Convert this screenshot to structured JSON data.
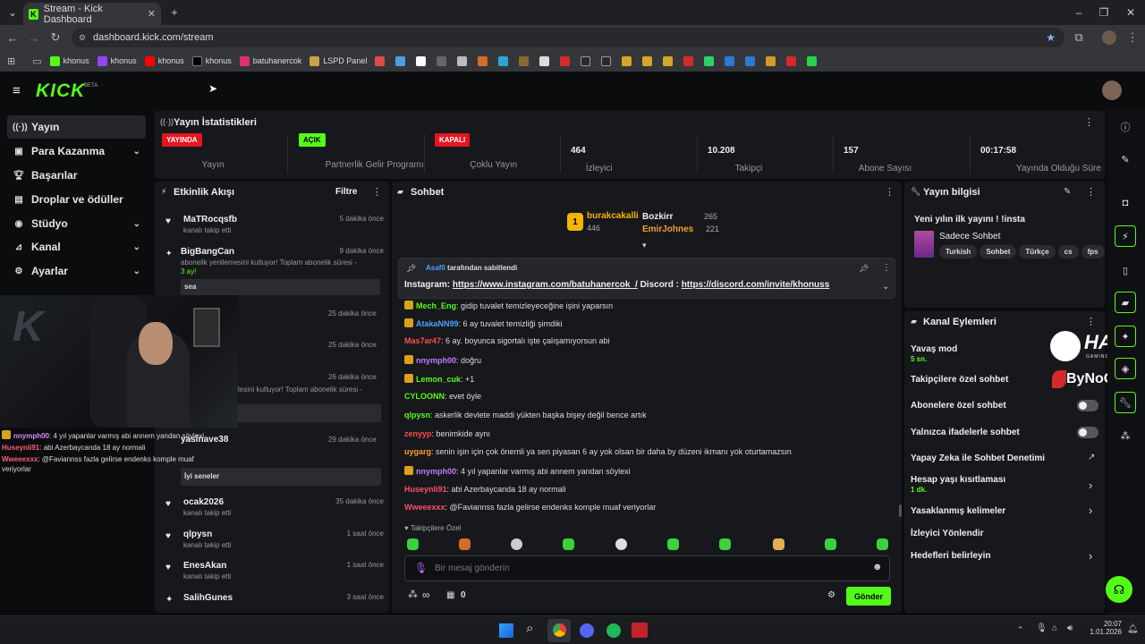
{
  "browser": {
    "tab_title": "Stream - Kick Dashboard",
    "url": "dashboard.kick.com/stream",
    "bookmarks": [
      "khonus",
      "khonus",
      "khonus",
      "khonus",
      "batuhanercok",
      "LSPD Panel"
    ],
    "taskbar_time": "20:07",
    "taskbar_date": "1.01.2026"
  },
  "app": {
    "logo": "KICK",
    "beta": "BETA"
  },
  "sidebar": {
    "items": [
      {
        "label": "Yayın",
        "icon": "broadcast-icon"
      },
      {
        "label": "Para Kazanma",
        "icon": "money-icon"
      },
      {
        "label": "Başarılar",
        "icon": "trophy-icon"
      },
      {
        "label": "Droplar ve ödüller",
        "icon": "gift-icon"
      },
      {
        "label": "Stüdyo",
        "icon": "studio-icon"
      },
      {
        "label": "Kanal",
        "icon": "channel-icon"
      },
      {
        "label": "Ayarlar",
        "icon": "gear-icon"
      }
    ]
  },
  "stats": {
    "title": "Yayın İstatistikleri",
    "items": [
      {
        "value": "YAYINDA",
        "label": "Yayın",
        "badge": "red"
      },
      {
        "value": "AÇIK",
        "label": "Partnerlik Gelir Programı",
        "badge": "green"
      },
      {
        "value": "KAPALI",
        "label": "Çoklu Yayın",
        "badge": "red"
      },
      {
        "value": "464",
        "label": "İzleyici"
      },
      {
        "value": "10.208",
        "label": "Takipçi"
      },
      {
        "value": "157",
        "label": "Abone Sayısı"
      },
      {
        "value": "00:17:58",
        "label": "Yayında Olduğu Süre"
      }
    ]
  },
  "activity": {
    "title": "Etkinlik Akışı",
    "filter": "Filtre",
    "items": [
      {
        "name": "MaTRocqsfb",
        "sub": "kanalı takip etti",
        "time": "5 dakika önce"
      },
      {
        "name": "BigBangCan",
        "sub": "abonelik yenilemesini kutluyor! Toplam abonelik süresi -",
        "sub2": "3 ay!",
        "time": "9 dakika önce",
        "note": "sea"
      },
      {
        "name": "",
        "sub": "",
        "time": "25 dakika önce"
      },
      {
        "name": "",
        "sub": "",
        "time": "25 dakika önce"
      },
      {
        "name": "",
        "sub": "lesini kutluyor! Toplam abonelik süresi -",
        "time": "26 dakika önce"
      },
      {
        "name": "yasinave38",
        "sub": "",
        "time": "29 dakika önce",
        "note": "İyi seneler"
      },
      {
        "name": "ocak2026",
        "sub": "kanalı takip etti",
        "time": "35 dakika önce"
      },
      {
        "name": "qlpysn",
        "sub": "kanalı takip etti",
        "time": "1 saat önce"
      },
      {
        "name": "EnesAkan",
        "sub": "kanalı takip etti",
        "time": "1 saat önce"
      },
      {
        "name": "SalihGunes",
        "sub": "",
        "time": "3 saat önce"
      }
    ]
  },
  "overlay_chat": [
    {
      "user": "nnymph00",
      "text": ": 4 yıl yapanlar varmış abi annem yandan söylexi",
      "color": "#d98cff"
    },
    {
      "user": "Huseynli91",
      "text": ": abi Azerbaycanda 18 ay normali",
      "color": "#ff5c7a"
    },
    {
      "user": "Wweeexxx",
      "text": ": @Faviannss fazla gelirse endenks komple muaf",
      "color": "#ff5c7a"
    },
    {
      "user": "",
      "text": "veriyorlar",
      "color": "#ddd"
    }
  ],
  "chat": {
    "title": "Sohbet",
    "top": [
      {
        "rank": "1",
        "name": "burakcakalli",
        "points": "446"
      },
      {
        "name": "Bozkirr",
        "points": "265"
      },
      {
        "name": "EmirJohnes",
        "points": "221"
      }
    ],
    "pinned_by": "Asaf0",
    "pinned_suffix": "tarafından sabitlendi",
    "pinned_text_a": "Instagram: ",
    "pinned_link_a": "https://www.instagram.com/batuhanercok_/",
    "pinned_text_b": "  Discord : ",
    "pinned_link_b": "https://discord.com/invite/khonuss",
    "messages": [
      {
        "user": "Mech_Eng",
        "text": ": gidip tuvalet temizleyeceğine işini yaparsın",
        "color": "#53fc18",
        "badge": true
      },
      {
        "user": "AtakaNN99",
        "text": ": 6 ay tuvalet temizliği şimdiki",
        "color": "#4aa3ff",
        "badge": true
      },
      {
        "user": "Mas7ar47",
        "text": ": 6 ay. boyunca sigortalı işte çalışamıyorsun abi",
        "color": "#ff4d4d",
        "badge": false
      },
      {
        "user": "nnymph00",
        "text": ": doğru",
        "color": "#c07cff",
        "badge": true
      },
      {
        "user": "Lemon_cuk",
        "text": ": +1",
        "color": "#53fc18",
        "badge": true
      },
      {
        "user": "CYLOONN",
        "text": ": evet öyle",
        "color": "#53fc18",
        "badge": false
      },
      {
        "user": "qlpysn",
        "text": ": askerlik devlete maddi yükten başka bişey değil bence artık",
        "color": "#53fc18",
        "badge": false
      },
      {
        "user": "zenyyp",
        "text": ": benimkide aynı",
        "color": "#ff4d4d",
        "badge": false
      },
      {
        "user": "uygarg",
        "text": ": senin işin için çok önemli ya sen piyasan 6 ay yok olsan bir daha by düzeni ikmanı yok oturtamazsın",
        "color": "#ff9a2e",
        "badge": false
      },
      {
        "user": "nnymph00",
        "text": ": 4 yıl yapanlar varmış abi annem yandan söylexi",
        "color": "#c07cff",
        "badge": true
      },
      {
        "user": "Huseynli91",
        "text": ": abi Azerbaycanda 18 ay normali",
        "color": "#ff4d6d",
        "badge": false
      },
      {
        "user": "Wweeexxx",
        "text": ": @Faviannss fazla gelirse endenks komple muaf veriyorlar",
        "color": "#ff4d6d",
        "badge": false
      }
    ],
    "followers_only": "Takipçilere Özel",
    "placeholder": "Bir mesaj gönderin",
    "points": "∞",
    "store_count": "0",
    "send": "Gönder"
  },
  "stream_info": {
    "title": "Yayın bilgisi",
    "stream_title": "Yeni yılın ilk yayını ! !insta",
    "category": "Sadece Sohbet",
    "tags": [
      "Turkish",
      "Sohbet",
      "Türkçe",
      "cs",
      "fps"
    ]
  },
  "channel_actions": {
    "title": "Kanal Eylemleri",
    "items": [
      {
        "label": "Yavaş mod",
        "sub": "5 sn."
      },
      {
        "label": "Takipçilere özel sohbet"
      },
      {
        "label": "Abonelere özel sohbet",
        "toggle": false
      },
      {
        "label": "Yalnızca ifadelerle sohbet",
        "toggle": false
      },
      {
        "label": "Yapay Zeka ile Sohbet Denetimi"
      },
      {
        "label": "Hesap yaşı kısıtlaması",
        "sub": "1 dk."
      },
      {
        "label": "Yasaklanmış kelimeler"
      },
      {
        "label": "İzleyici Yönlendir"
      },
      {
        "label": "Hedefleri belirleyin"
      }
    ]
  },
  "sponsors": {
    "a": "HAWK",
    "a_sub": "GAMING CHAIR",
    "b": "ByNoGame"
  },
  "colors": {
    "accent": "#53fc18",
    "bg": "#0b0c0e",
    "panel": "#17181c",
    "live": "#e5151f"
  }
}
